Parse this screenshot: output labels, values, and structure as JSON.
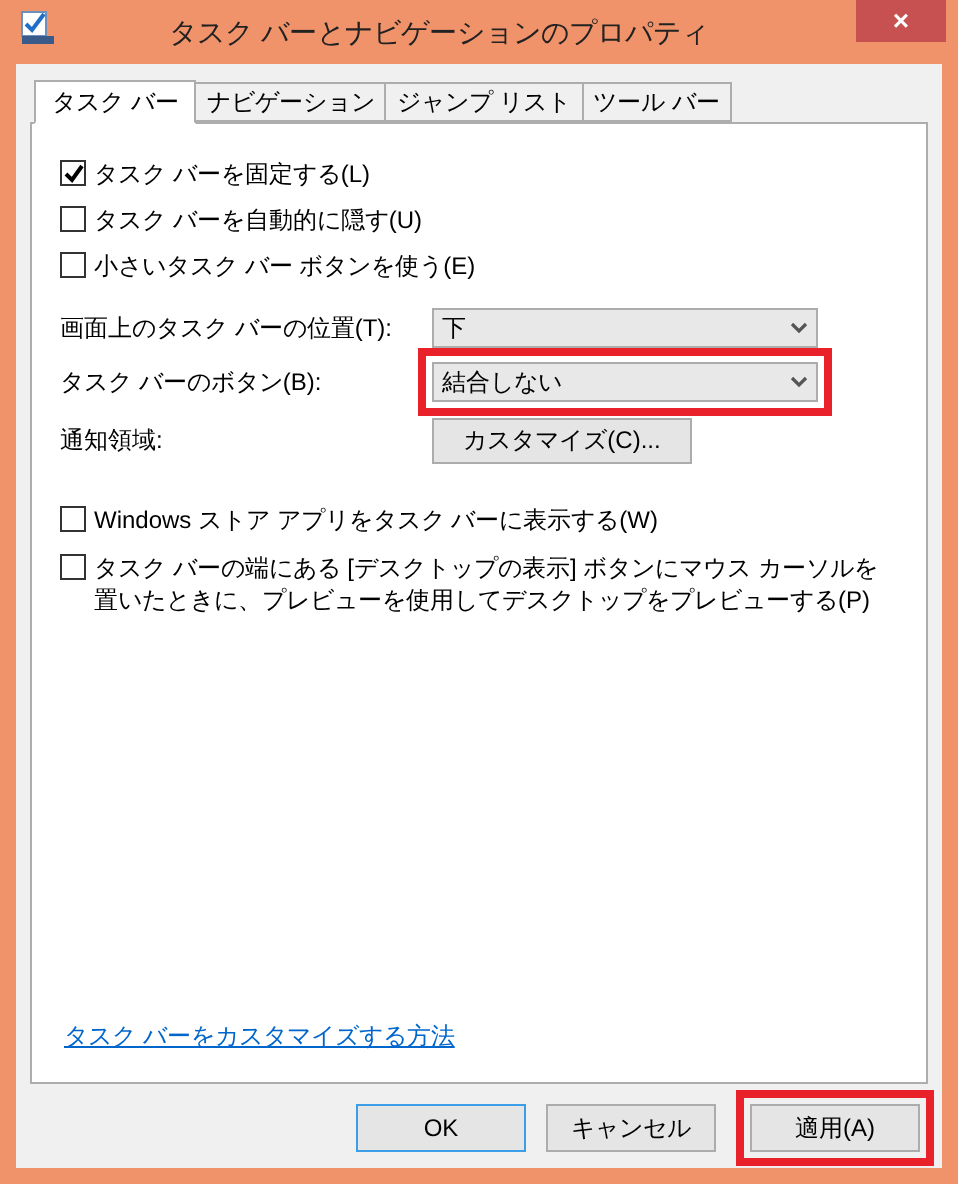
{
  "window": {
    "title": "タスク バーとナビゲーションのプロパティ",
    "close": "×"
  },
  "tabs": [
    {
      "label": "タスク バー",
      "selected": true
    },
    {
      "label": "ナビゲーション",
      "selected": false
    },
    {
      "label": "ジャンプ リスト",
      "selected": false
    },
    {
      "label": "ツール バー",
      "selected": false
    }
  ],
  "options": [
    {
      "label": "タスク バーを固定する(L)",
      "checked": true
    },
    {
      "label": "タスク バーを自動的に隠す(U)",
      "checked": false
    },
    {
      "label": "小さいタスク バー ボタンを使う(E)",
      "checked": false
    }
  ],
  "settings": [
    {
      "kind": "dropdown",
      "label": "画面上のタスク バーの位置(T):",
      "value": "下",
      "highlighted": false
    },
    {
      "kind": "dropdown",
      "label": "タスク バーのボタン(B):",
      "value": "結合しない",
      "highlighted": true
    },
    {
      "kind": "button",
      "label": "通知領域:",
      "value": "カスタマイズ(C)...",
      "highlighted": false
    }
  ],
  "more_options": [
    {
      "label": "Windows ストア アプリをタスク バーに表示する(W)",
      "checked": false
    },
    {
      "label": "タスク バーの端にある [デスクトップの表示] ボタンにマウス カーソルを置いたときに、プレビューを使用してデスクトップをプレビューする(P)",
      "checked": false
    }
  ],
  "help_link": "タスク バーをカスタマイズする方法",
  "buttons": [
    {
      "label": "OK",
      "default": true,
      "highlighted": false
    },
    {
      "label": "キャンセル",
      "default": false,
      "highlighted": false
    },
    {
      "label": "適用(A)",
      "default": false,
      "highlighted": true
    }
  ]
}
